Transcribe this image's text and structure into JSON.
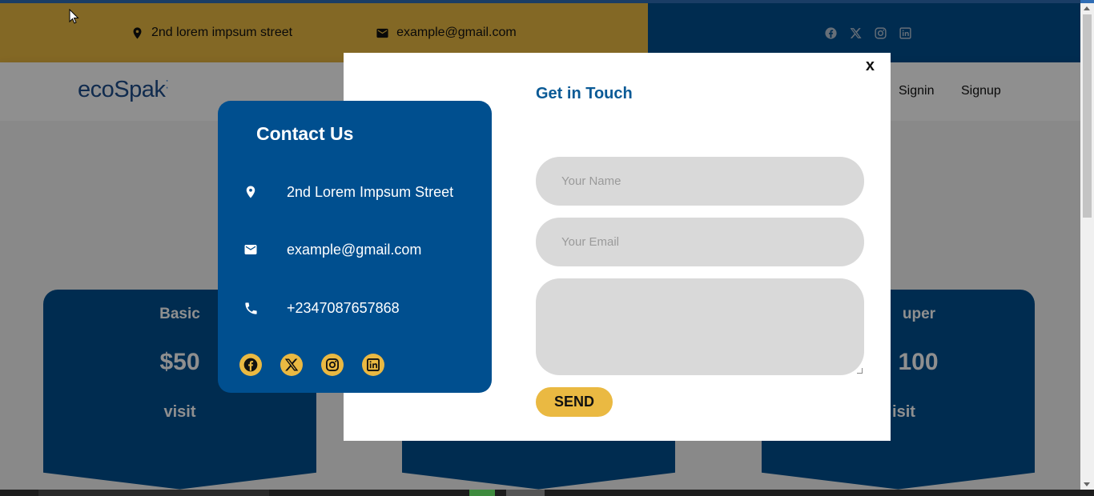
{
  "topbar": {
    "address": "2nd lorem impsum street",
    "email": "example@gmail.com",
    "social_icons": [
      "facebook-icon",
      "x-icon",
      "instagram-icon",
      "linkedin-icon"
    ]
  },
  "navbar": {
    "logo": "ecoSpak",
    "links": [
      "Signin",
      "Signup"
    ]
  },
  "pricing": {
    "cards": [
      {
        "title": "Basic",
        "price": "$50",
        "action": "visit"
      },
      {
        "title": "",
        "price": "",
        "action": ""
      },
      {
        "title": "uper",
        "price": "100",
        "action": "isit"
      }
    ]
  },
  "modal": {
    "close_label": "x",
    "title": "Get in Touch",
    "name_placeholder": "Your Name",
    "email_placeholder": "Your Email",
    "message_value": "",
    "send_label": "SEND"
  },
  "contact": {
    "title": "Contact Us",
    "address": "2nd Lorem Impsum Street",
    "email": "example@gmail.com",
    "phone": "+2347087657868",
    "social_icons": [
      "facebook-icon",
      "x-icon",
      "instagram-icon",
      "linkedin-icon"
    ]
  },
  "colors": {
    "brand_blue": "#004f8f",
    "accent_yellow": "#eab942",
    "input_gray": "#d9d9d9"
  }
}
